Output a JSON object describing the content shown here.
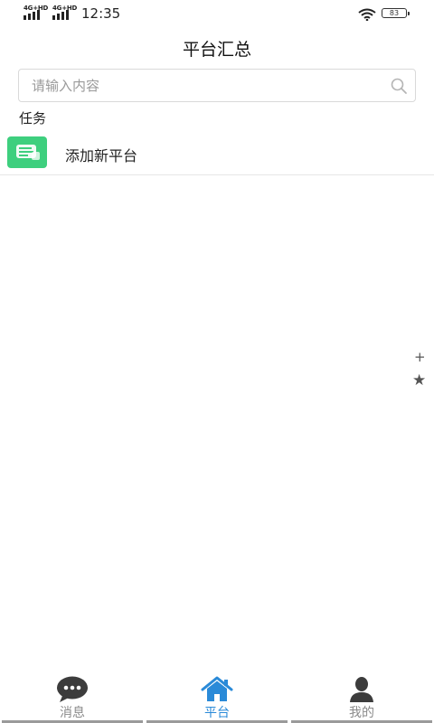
{
  "status_bar": {
    "network_1": "4G+HD",
    "network_2": "4G+HD",
    "time": "12:35",
    "battery": "83"
  },
  "header": {
    "title": "平台汇总"
  },
  "search": {
    "placeholder": "请输入内容",
    "icon": "search-icon"
  },
  "section": {
    "title": "任务"
  },
  "list": {
    "items": [
      {
        "label": "添加新平台",
        "icon": "chat-card-icon",
        "icon_color": "#3ecf7e"
      }
    ]
  },
  "floating": {
    "plus": "+",
    "star": "★"
  },
  "tabs": [
    {
      "label": "消息",
      "icon": "chat-bubble-icon",
      "active": false
    },
    {
      "label": "平台",
      "icon": "home-icon",
      "active": true
    },
    {
      "label": "我的",
      "icon": "user-icon",
      "active": false
    }
  ],
  "colors": {
    "accent": "#2a8ad8",
    "tab_inactive": "#8a8a8a",
    "list_icon_bg": "#3ecf7e"
  }
}
